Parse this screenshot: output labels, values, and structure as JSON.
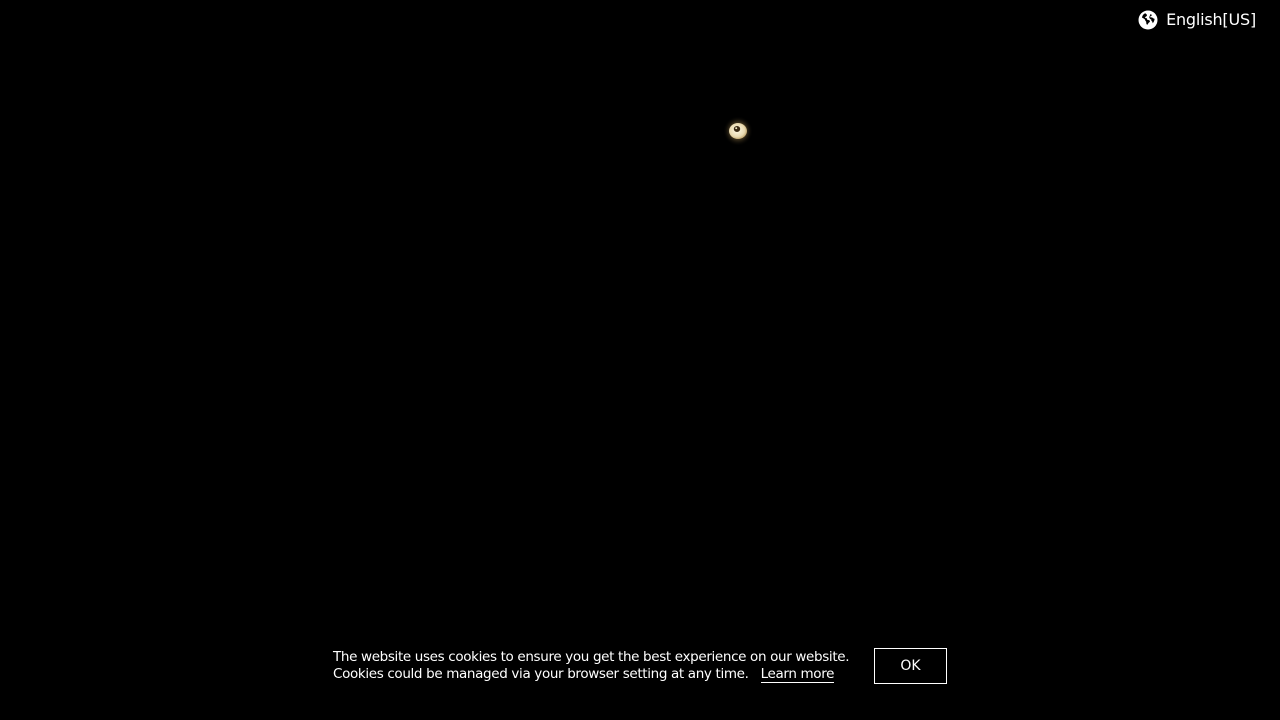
{
  "language_selector": {
    "label": "English[US]",
    "icon": "globe-icon"
  },
  "background_color": "#000000",
  "orb": {
    "icon": "glowing-eye-icon",
    "color": "#e8d9b0"
  },
  "cookie_banner": {
    "line1": "The website uses cookies to ensure you get the best experience on our website.",
    "line2": "Cookies could be managed via your browser setting at any time.",
    "learn_more_label": "Learn more",
    "ok_label": "OK"
  }
}
